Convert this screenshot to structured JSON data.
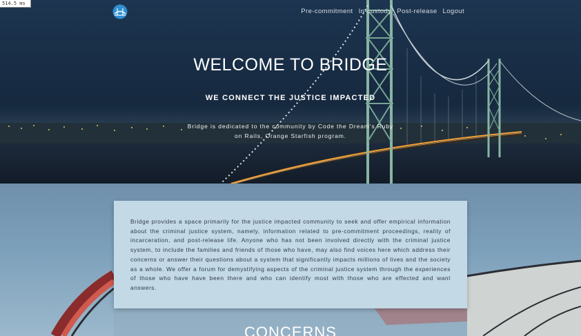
{
  "debug": {
    "timer_label": "514.5 ms"
  },
  "navbar": {
    "logo_icon": "bridge-logo-icon",
    "links": [
      {
        "label": "Pre-commitment"
      },
      {
        "label": "In-custody"
      },
      {
        "label": "Post-release"
      },
      {
        "label": "Logout"
      }
    ]
  },
  "hero": {
    "title": "WELCOME TO BRIDGE",
    "subtitle": "WE CONNECT THE JUSTICE IMPACTED",
    "description": "Bridge is dedicated to the community by Code the Dream's Ruby on Rails, Orange Starfish program.",
    "background_image": "night suspension bridge over city lights"
  },
  "about": {
    "text": "Bridge provides a space primarily for the justice impacted community to seek and offer empirical information about the criminal justice system, namely, information related to pre-commitment proceedings, reality of incarceration, and post-release life. Anyone who has not been involved directly with the criminal justice system, to include the families and friends of those who have, may also find voices here which address their concerns or answer their questions about a system that significantly impacts millions of lives and the society as a whole. We offer a forum for demystifying aspects of the criminal justice system through the experiences of those who have have been there and who can identify most with those who are effected and want answers."
  },
  "concerns": {
    "heading": "CONCERNS"
  },
  "colors": {
    "card_bg": "#c3d9e6",
    "section_bg": "#7ea1bb",
    "hero_bg": "#182c44",
    "text_dark": "#2e3b45"
  }
}
